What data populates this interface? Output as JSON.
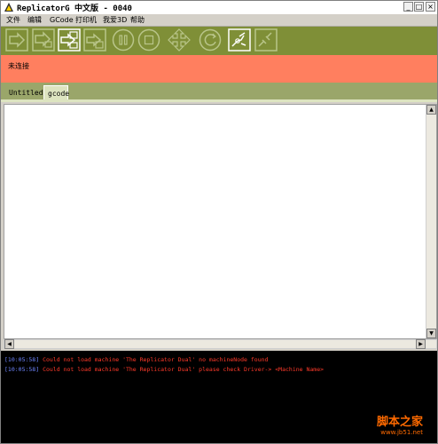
{
  "window": {
    "title": "ReplicatorG 中文版 - 0040"
  },
  "title_buttons": {
    "minimize": "_",
    "maximize": "□",
    "close": "×"
  },
  "menu": {
    "items": [
      "文件",
      "编辑",
      "GCode",
      "打印机",
      "我爱3D",
      "帮助"
    ]
  },
  "toolbar": {
    "buttons": [
      {
        "name": "build-icon",
        "enabled": false
      },
      {
        "name": "upload-icon",
        "enabled": false
      },
      {
        "name": "build-to-file-icon",
        "enabled": true
      },
      {
        "name": "build-remote-icon",
        "enabled": false
      },
      {
        "name": "pause-icon",
        "enabled": false
      },
      {
        "name": "stop-icon",
        "enabled": false
      },
      {
        "name": "control-panel-icon",
        "enabled": false
      },
      {
        "name": "reset-icon",
        "enabled": false
      },
      {
        "name": "connect-icon",
        "enabled": true
      },
      {
        "name": "disconnect-icon",
        "enabled": false
      }
    ]
  },
  "status": {
    "text": "未连接",
    "color": "#ff7f5f"
  },
  "tabs": [
    {
      "label": "Untitled",
      "active": false
    },
    {
      "label": "gcode",
      "active": true
    }
  ],
  "editor": {
    "content": ""
  },
  "scroll": {
    "up": "▲",
    "down": "▼",
    "left": "◀",
    "right": "▶"
  },
  "console": {
    "lines": [
      {
        "time": "[10:05:58]",
        "message": "Could not load machine 'The Replicator Dual' no machineNode found"
      },
      {
        "time": "[10:05:58]",
        "message": "Could not load machine 'The Replicator Dual' please check Driver-> <Machine Name>"
      }
    ]
  },
  "watermark": {
    "main": "脚本之家",
    "sub": "www.jb51.net"
  },
  "colors": {
    "toolbar": "#7f8f37",
    "status": "#ff7f5f",
    "tabbar": "#9aa66a",
    "console": "#000000",
    "timestamp": "#6f86ff",
    "error": "#ff3a2a"
  }
}
